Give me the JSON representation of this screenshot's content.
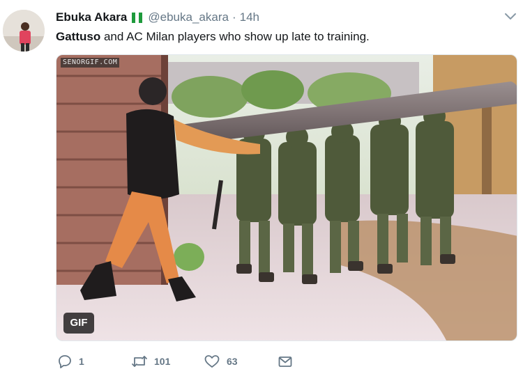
{
  "author": {
    "name": "Ebuka Akara",
    "handle": "@ebuka_akara",
    "separator": "·",
    "time": "14h"
  },
  "flag_colors": [
    "#1e9a3c",
    "#ffffff",
    "#1e9a3c"
  ],
  "tweet": {
    "bold_part": "Gattuso",
    "rest": " and AC Milan players who show up late to training."
  },
  "media": {
    "watermark": "SENORGIF.COM",
    "badge": "GIF",
    "type": "animated-gif"
  },
  "actions": {
    "reply": {
      "icon": "reply-icon",
      "count": "1"
    },
    "retweet": {
      "icon": "retweet-icon",
      "count": "101"
    },
    "like": {
      "icon": "heart-icon",
      "count": "63"
    },
    "dm": {
      "icon": "envelope-icon"
    }
  },
  "colors": {
    "text": "#14171a",
    "secondary": "#657786",
    "border": "#e1e8ed"
  }
}
